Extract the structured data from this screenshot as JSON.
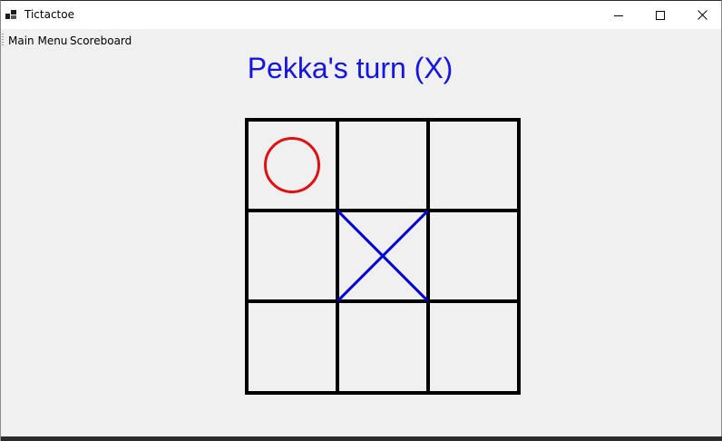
{
  "window": {
    "title": "Tictactoe",
    "icon": "app-grid-icon",
    "controls": {
      "minimize": "minimize-icon",
      "maximize": "maximize-icon",
      "close": "close-icon"
    }
  },
  "menu": {
    "items": [
      {
        "label": "Main Menu"
      },
      {
        "label": "Scoreboard"
      }
    ]
  },
  "game": {
    "status": "Pekka's turn (X)",
    "status_color": "#1414e6",
    "x_color": "#0000dd",
    "o_color": "#e01010",
    "grid_color": "#000000",
    "board": [
      [
        "O",
        "",
        ""
      ],
      [
        "",
        "X",
        ""
      ],
      [
        "",
        "",
        ""
      ]
    ]
  }
}
